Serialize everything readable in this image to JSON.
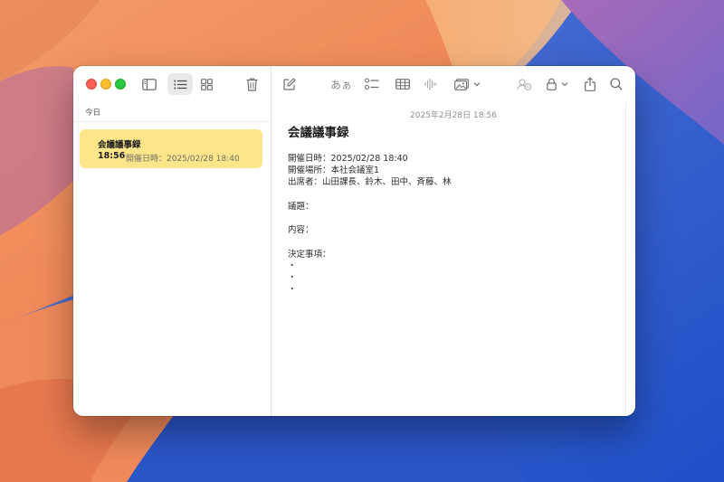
{
  "window": {
    "toolbar": {
      "format_label": "あぁ"
    },
    "sidebar": {
      "section_label": "今日",
      "notes": [
        {
          "title": "会議議事録",
          "time": "18:56",
          "preview": "開催日時：2025/02/28 18:40"
        }
      ]
    },
    "editor": {
      "timestamp": "2025年2月28日 18:56",
      "title": "会議議事録",
      "lines": [
        "開催日時：2025/02/28 18:40",
        "開催場所：本社会議室1",
        "出席者：山田課長、鈴木、田中、斉藤、林",
        "",
        "議題：",
        "",
        "内容：",
        "",
        "決定事項：",
        "・",
        "・",
        "・"
      ]
    }
  },
  "colors": {
    "note_highlight": "#fde58a",
    "close": "#ff5f57",
    "minimize": "#febc2e",
    "zoom": "#28c840"
  }
}
